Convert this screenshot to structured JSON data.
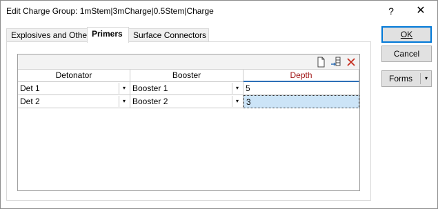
{
  "window": {
    "title": "Edit Charge Group: 1mStem|3mCharge|0.5Stem|Charge",
    "help_glyph": "?",
    "close_glyph": "✕"
  },
  "tabs": [
    {
      "label": "Explosives and Others",
      "active": false
    },
    {
      "label": "Primers",
      "active": true
    },
    {
      "label": "Surface Connectors",
      "active": false
    }
  ],
  "grid": {
    "toolbar": {
      "icons": [
        "new-document-icon",
        "insert-row-icon",
        "delete-icon"
      ],
      "delete_color": "#c42b1c"
    },
    "columns": [
      "Detonator",
      "Booster",
      "Depth"
    ],
    "active_column": "Depth",
    "rows": [
      {
        "detonator": "Det 1",
        "booster": "Booster 1",
        "depth": "5"
      },
      {
        "detonator": "Det 2",
        "booster": "Booster 2",
        "depth": "3"
      }
    ],
    "selected_row": 2,
    "dropdown_glyph": "▾"
  },
  "buttons": {
    "ok": {
      "label": "OK",
      "accent": "u"
    },
    "cancel": {
      "label": "Cancel",
      "accent": "u"
    },
    "forms": {
      "label": "Forms",
      "arrow": "▾"
    }
  },
  "colors": {
    "accent_blue": "#0078d7",
    "selected_cell": "#cce4f7",
    "active_header_text": "#a31a1a"
  }
}
